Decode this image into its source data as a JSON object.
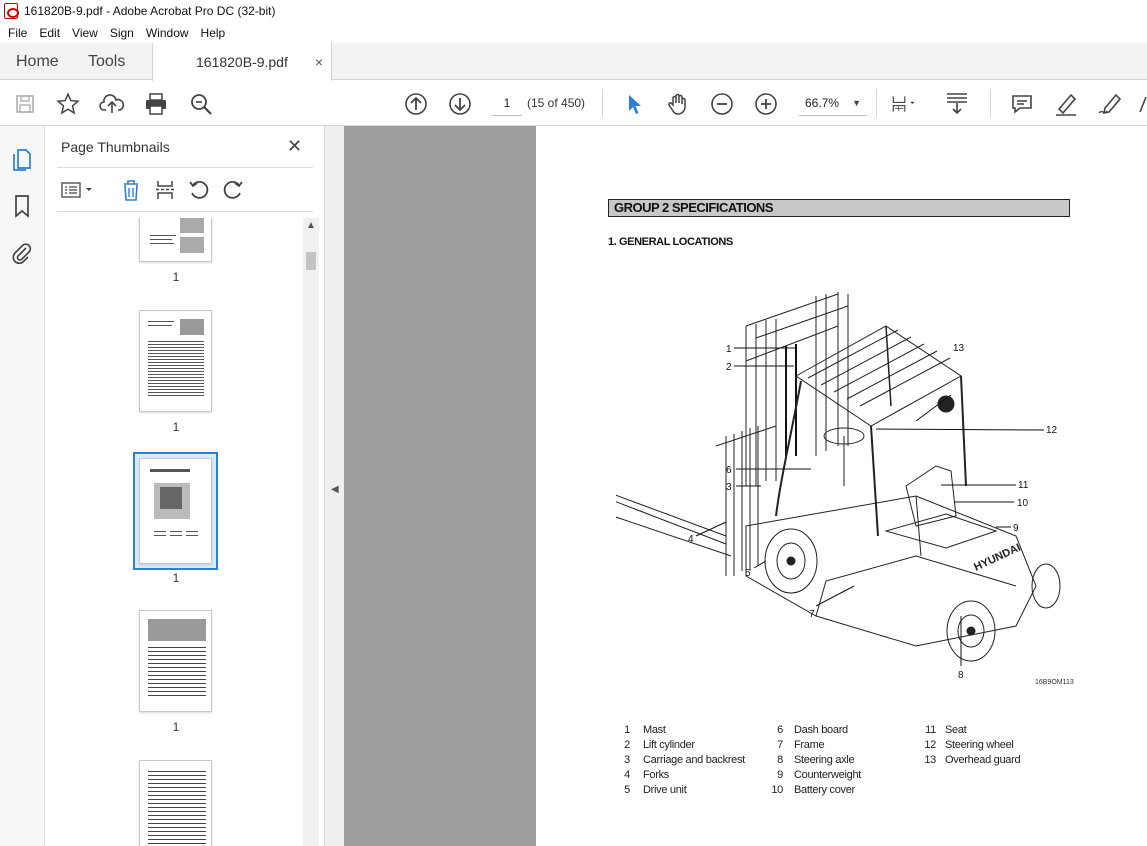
{
  "window": {
    "title": "161820B-9.pdf - Adobe Acrobat Pro DC (32-bit)"
  },
  "menu": [
    "File",
    "Edit",
    "View",
    "Sign",
    "Window",
    "Help"
  ],
  "tabs": {
    "home": "Home",
    "tools": "Tools",
    "doc": "161820B-9.pdf",
    "doc_close": "×"
  },
  "toolbar": {
    "page_current": "1",
    "page_count": "(15 of 450)",
    "zoom": "66.7%",
    "zoom_caret": "▼"
  },
  "panel": {
    "title": "Page Thumbnails",
    "close": "✕",
    "thumbnail_labels": [
      "1",
      "1",
      "1",
      "1"
    ]
  },
  "document": {
    "group_header": "GROUP 2  SPECIFICATIONS",
    "section_title": "1. GENERAL LOCATIONS",
    "figure_code": "16B9OM113",
    "callouts": [
      "1",
      "2",
      "13",
      "12",
      "6",
      "3",
      "11",
      "10",
      "9",
      "4",
      "5",
      "7",
      "8"
    ],
    "legend": [
      {
        "num": "1",
        "label": "Mast"
      },
      {
        "num": "2",
        "label": "Lift cylinder"
      },
      {
        "num": "3",
        "label": "Carriage and backrest"
      },
      {
        "num": "4",
        "label": "Forks"
      },
      {
        "num": "5",
        "label": "Drive unit"
      },
      {
        "num": "6",
        "label": "Dash board"
      },
      {
        "num": "7",
        "label": "Frame"
      },
      {
        "num": "8",
        "label": "Steering axle"
      },
      {
        "num": "9",
        "label": "Counterweight"
      },
      {
        "num": "10",
        "label": "Battery cover"
      },
      {
        "num": "11",
        "label": "Seat"
      },
      {
        "num": "12",
        "label": "Steering wheel"
      },
      {
        "num": "13",
        "label": "Overhead guard"
      }
    ]
  },
  "colors": {
    "accent_blue": "#2d7fd3",
    "doc_background": "#9d9d9d",
    "header_fill": "#c8c8c8"
  }
}
